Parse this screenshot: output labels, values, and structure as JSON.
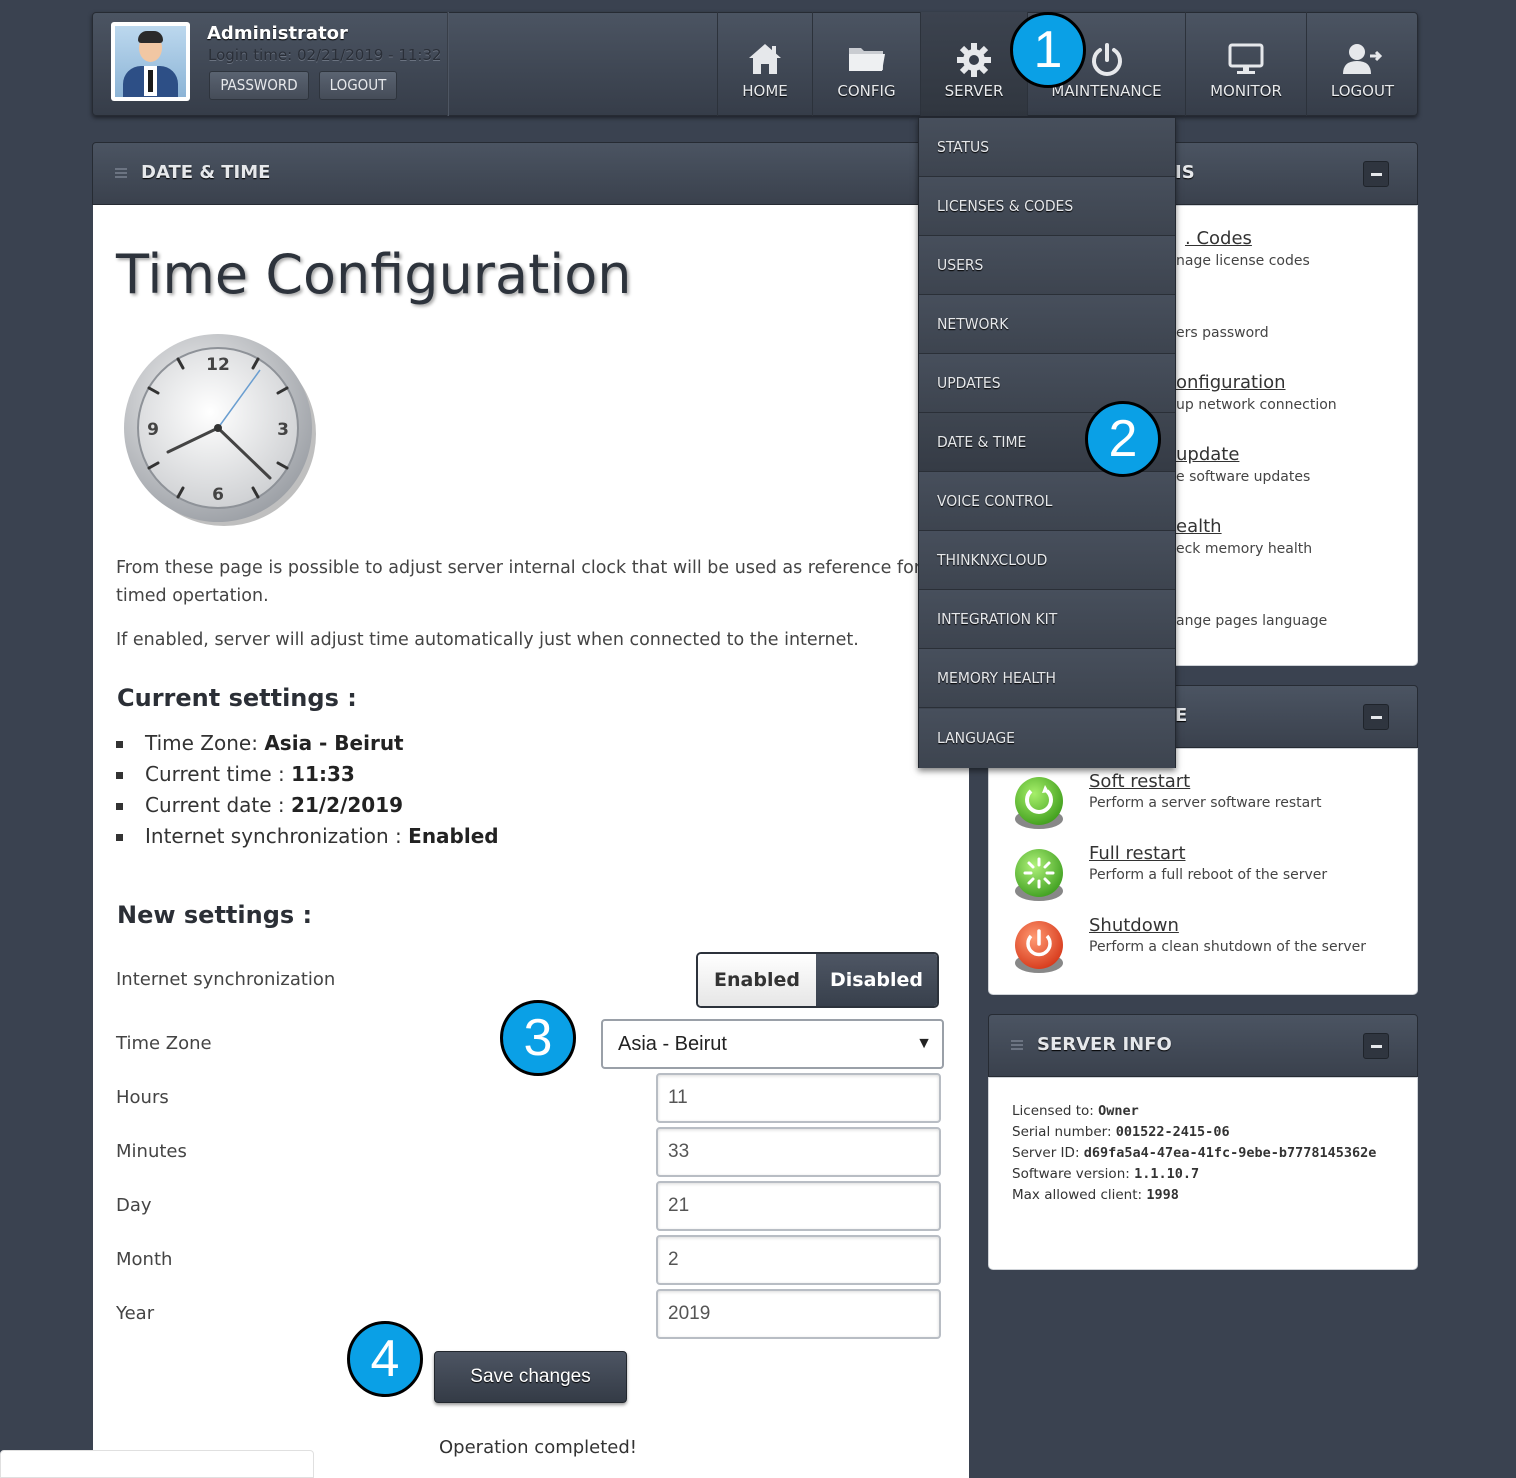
{
  "user": {
    "name": "Administrator",
    "login_time": "Login time: 02/21/2019 - 11:32",
    "password_btn": "PASSWORD",
    "logout_btn": "LOGOUT"
  },
  "nav": {
    "home": "HOME",
    "config": "CONFIG",
    "server": "SERVER",
    "maintenance": "MAINTENANCE",
    "monitor": "MONITOR",
    "logout": "LOGOUT"
  },
  "main": {
    "panel_title": "DATE & TIME",
    "title": "Time Configuration",
    "clock": {
      "n12": "12",
      "n3": "3",
      "n6": "6",
      "n9": "9"
    },
    "para1_line1": "From these page is possible to adjust server internal clock that will be used as reference for all",
    "para1_line2": "timed opertation.",
    "para2": "If enabled, server will adjust time automatically just when connected to the internet.",
    "current_heading": "Current settings :",
    "current": {
      "tz_label": "Time Zone: ",
      "tz_value": "Asia - Beirut",
      "time_label": "Current time : ",
      "time_value": "11:33",
      "date_label": "Current date : ",
      "date_value": "21/2/2019",
      "sync_label": "Internet synchronization : ",
      "sync_value": "Enabled"
    },
    "new_heading": "New settings :",
    "form": {
      "sync_label": "Internet synchronization",
      "sync_on": "Enabled",
      "sync_off": "Disabled",
      "tz_label": "Time Zone",
      "tz_value": "Asia - Beirut",
      "hours_label": "Hours",
      "hours": "11",
      "minutes_label": "Minutes",
      "minutes": "33",
      "day_label": "Day",
      "day": "21",
      "month_label": "Month",
      "month": "2",
      "year_label": "Year",
      "year": "2019",
      "save": "Save changes",
      "result": "Operation completed!"
    }
  },
  "dropdown": [
    "STATUS",
    "LICENSES & CODES",
    "USERS",
    "NETWORK",
    "UPDATES",
    "DATE & TIME",
    "VOICE CONTROL",
    "THINKNXCLOUD",
    "INTEGRATION KIT",
    "MEMORY HEALTH",
    "LANGUAGE"
  ],
  "right": {
    "panel1_title_visible": "IS",
    "panel1_items": [
      {
        "link": ". Codes",
        "desc": "nage license codes"
      },
      {
        "link": "",
        "desc": "ers password"
      },
      {
        "link": "onfiguration",
        "desc": "up network connection"
      },
      {
        "link": "update",
        "desc": "e software updates"
      },
      {
        "link": "ealth",
        "desc": "eck memory health"
      },
      {
        "link": "",
        "desc": "ange pages language"
      }
    ],
    "panel2_title_visible": "E",
    "panel2_items": [
      {
        "link": "Soft restart",
        "desc": "Perform a server software restart"
      },
      {
        "link": "Full restart",
        "desc": "Perform a full reboot of the server"
      },
      {
        "link": "Shutdown",
        "desc": "Perform a clean shutdown of the server"
      }
    ],
    "panel3_title": "SERVER INFO",
    "server_info": {
      "licensed_label": "Licensed to: ",
      "licensed": "Owner",
      "serial_label": "Serial number: ",
      "serial": "001522-2415-06",
      "id_label": "Server ID: ",
      "id": "d69fa5a4-47ea-41fc-9ebe-b7778145362e",
      "version_label": "Software version: ",
      "version": "1.1.10.7",
      "max_label": "Max allowed client: ",
      "max": "1998"
    }
  },
  "callouts": [
    "1",
    "2",
    "3",
    "4"
  ],
  "colors": {
    "callout": "#0aa0e6",
    "header": "#3a414d",
    "background": "#3a4250"
  }
}
